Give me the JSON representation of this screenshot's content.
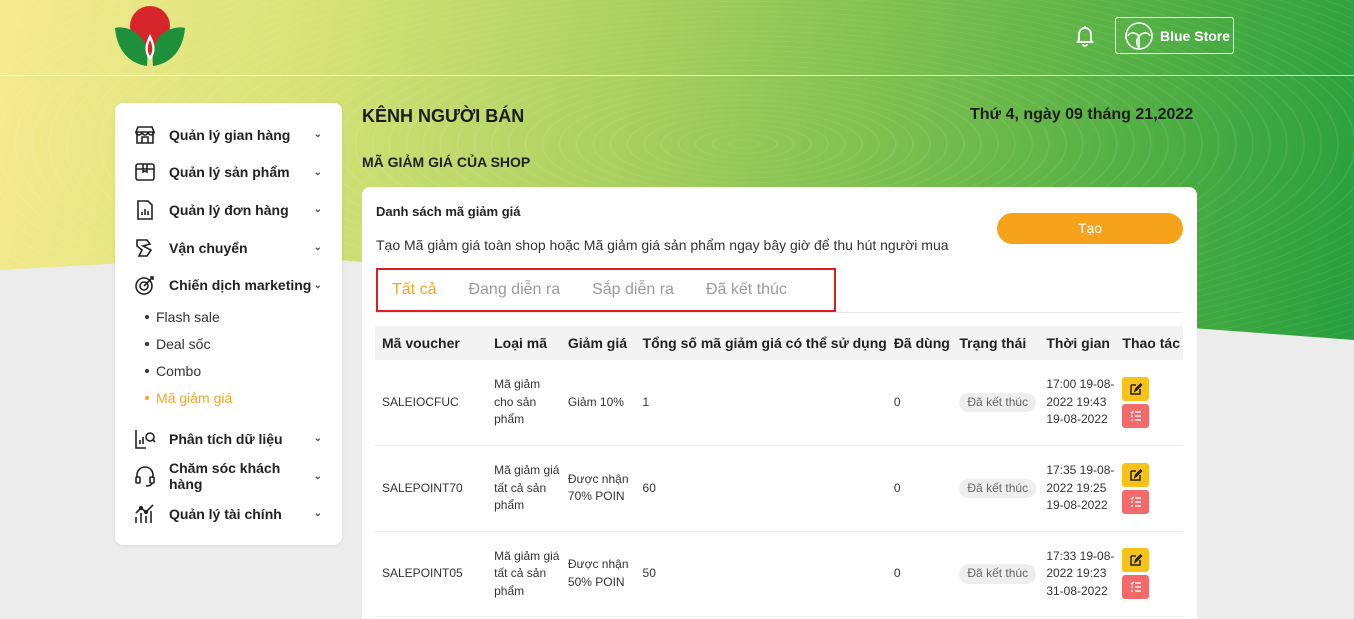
{
  "header": {
    "store_name": "Blue Store",
    "icons": {
      "logo": "brand-logo",
      "notification": "bell-icon",
      "store": "store-logo-icon"
    },
    "colors": {
      "brand_red": "#d7262b",
      "brand_green": "#1e9b3c"
    }
  },
  "sidebar": {
    "items": [
      {
        "label": "Quản lý gian hàng",
        "icon": "store-icon"
      },
      {
        "label": "Quản lý sản phẩm",
        "icon": "box-icon"
      },
      {
        "label": "Quản lý đơn hàng",
        "icon": "order-icon"
      },
      {
        "label": "Vận chuyển",
        "icon": "shipping-icon"
      },
      {
        "label": "Chiến dịch marketing",
        "icon": "target-icon"
      }
    ],
    "sub_items": [
      {
        "label": "Flash sale"
      },
      {
        "label": "Deal sốc"
      },
      {
        "label": "Combo"
      },
      {
        "label": "Mã giảm giá"
      }
    ],
    "items_after": [
      {
        "label": "Phân tích dữ liệu",
        "icon": "analytics-icon"
      },
      {
        "label": "Chăm sóc khách hàng",
        "icon": "headset-icon"
      },
      {
        "label": "Quản lý tài chính",
        "icon": "finance-icon"
      }
    ],
    "accent": "#f5a623"
  },
  "main": {
    "title": "KÊNH NGƯỜI BÁN",
    "date": "Thứ 4, ngày 09 tháng 21,2022",
    "section_title": "MÃ GIẢM GIÁ CỦA SHOP",
    "card_title": "Danh sách mã giảm giá",
    "card_desc": "Tạo Mã giảm giá toàn shop hoặc Mã giảm giá sản phẩm ngay bây giờ để thu hút người mua",
    "create_label": "Tạo",
    "tabs": [
      {
        "label": "Tất cả"
      },
      {
        "label": "Đang diễn ra"
      },
      {
        "label": "Sắp diễn ra"
      },
      {
        "label": "Đã kết thúc"
      }
    ],
    "table": {
      "headers": [
        "Mã voucher",
        "Loại mã",
        "Giảm giá",
        "Tổng số mã giảm giá có thể sử dụng",
        "Đã dùng",
        "Trạng thái",
        "Thời gian",
        "Thao tác"
      ],
      "rows": [
        {
          "code": "SALEIOCFUC",
          "type": "Mã giảm cho sản phẩm",
          "discount": "Giảm 10%",
          "total": "1",
          "used": "0",
          "status": "Đã kết thúc",
          "time": "17:00 19-08-2022 19:43 19-08-2022"
        },
        {
          "code": "SALEPOINT70",
          "type": "Mã giảm giá tất cả sản phẩm",
          "discount": "Được nhận 70% POIN",
          "total": "60",
          "used": "0",
          "status": "Đã kết thúc",
          "time": "17:35 19-08-2022 19:25 19-08-2022"
        },
        {
          "code": "SALEPOINT05",
          "type": "Mã giảm giá tất cả sản phẩm",
          "discount": "Được nhận 50% POIN",
          "total": "50",
          "used": "0",
          "status": "Đã kết thúc",
          "time": "17:33 19-08-2022 19:23 31-08-2022"
        }
      ]
    }
  }
}
